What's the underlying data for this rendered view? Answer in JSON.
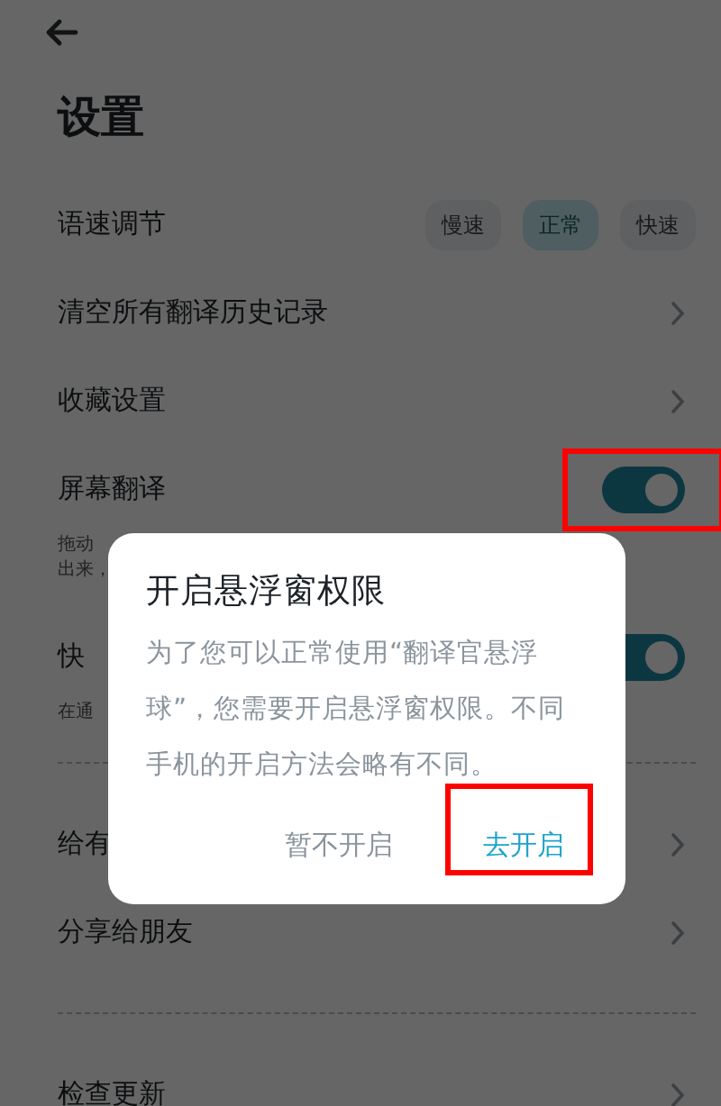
{
  "title": "设置",
  "settings": [
    {
      "kind": "speed",
      "label": "语速调节",
      "options": [
        {
          "label": "慢速",
          "selected": false
        },
        {
          "label": "正常",
          "selected": true
        },
        {
          "label": "快速",
          "selected": false
        }
      ]
    },
    {
      "kind": "link",
      "label": "清空所有翻译历史记录"
    },
    {
      "kind": "link",
      "label": "收藏设置"
    },
    {
      "kind": "toggle",
      "label": "屏幕翻译",
      "on": true,
      "highlighted": true,
      "description_lines": [
        "拖动",
        "出来，"
      ]
    },
    {
      "kind": "toggle",
      "label": "快",
      "on": true,
      "description_lines": [
        "在通"
      ],
      "divider_after": true
    },
    {
      "kind": "link",
      "label": "给有"
    },
    {
      "kind": "link",
      "label": "分享给朋友",
      "divider_after": true
    },
    {
      "kind": "link",
      "label": "检查更新"
    }
  ],
  "dialog": {
    "title": "开启悬浮窗权限",
    "message": "为了您可以正常使用“翻译官悬浮球”，您需要开启悬浮窗权限。不同手机的开启方法会略有不同。",
    "buttons": [
      {
        "label": "暂不开启",
        "kind": "secondary",
        "highlighted": false
      },
      {
        "label": "去开启",
        "kind": "primary",
        "highlighted": true
      }
    ]
  }
}
